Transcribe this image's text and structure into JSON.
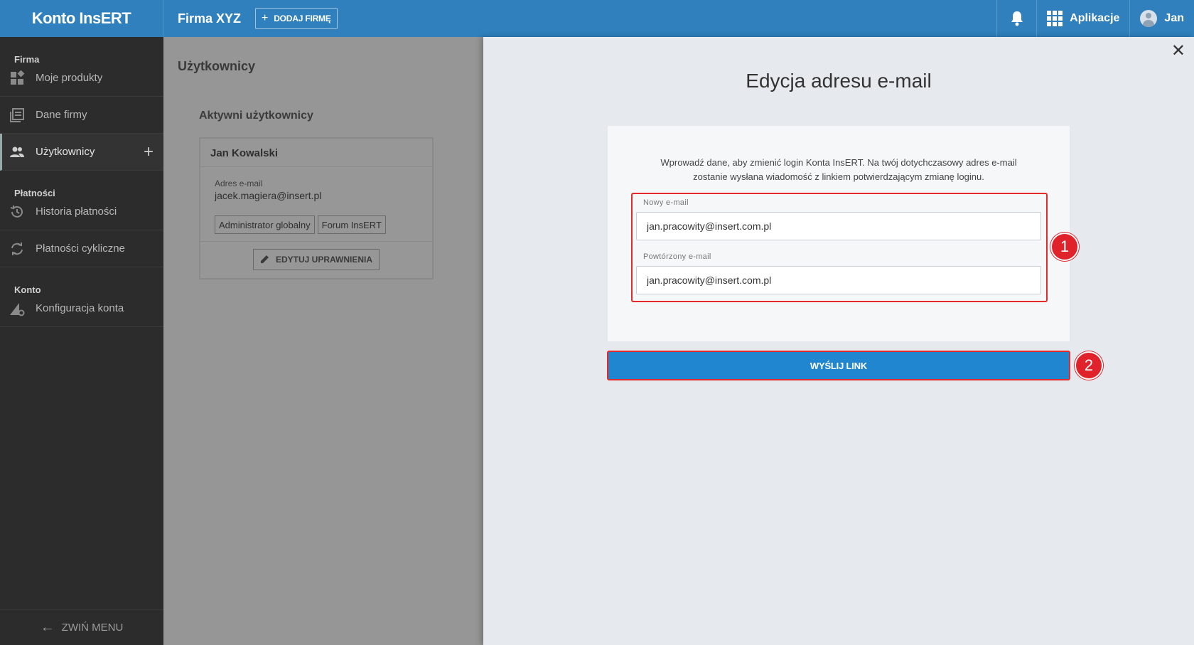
{
  "topbar": {
    "brand": "Konto InsERT",
    "company": "Firma XYZ",
    "add_company": "DODAJ FIRMĘ",
    "apps": "Aplikacje",
    "user": "Jan"
  },
  "sidebar": {
    "sections": [
      {
        "title": "Firma",
        "items": [
          {
            "label": "Moje produkty",
            "icon": "products-icon"
          },
          {
            "label": "Dane firmy",
            "icon": "company-data-icon"
          },
          {
            "label": "Użytkownicy",
            "icon": "users-icon",
            "active": true
          }
        ]
      },
      {
        "title": "Płatności",
        "items": [
          {
            "label": "Historia płatności",
            "icon": "history-icon"
          },
          {
            "label": "Płatności cykliczne",
            "icon": "recurring-icon"
          }
        ]
      },
      {
        "title": "Konto",
        "items": [
          {
            "label": "Konfiguracja konta",
            "icon": "account-settings-icon"
          }
        ]
      }
    ],
    "collapse": "ZWIŃ MENU"
  },
  "content": {
    "title": "Użytkownicy",
    "subtitle": "Aktywni użytkownicy",
    "user_card": {
      "name": "Jan Kowalski",
      "email_label": "Adres e-mail",
      "email": "jacek.magiera@insert.pl",
      "roles": [
        "Administrator globalny",
        "Forum InsERT"
      ],
      "edit_button": "EDYTUJ UPRAWNIENIA"
    }
  },
  "panel": {
    "title": "Edycja adresu e-mail",
    "description_line1": "Wprowadź dane, aby zmienić login Konta InsERT. Na twój dotychczasowy adres e-mail",
    "description_line2": "zostanie wysłana wiadomość z linkiem potwierdzającym zmianę loginu.",
    "new_email_label": "Nowy e-mail",
    "new_email_value": "jan.pracowity@insert.com.pl",
    "repeat_email_label": "Powtórzony e-mail",
    "repeat_email_value": "jan.pracowity@insert.com.pl",
    "send_button": "WYŚLIJ LINK",
    "badge1": "1",
    "badge2": "2"
  },
  "colors": {
    "topbar": "#2f80bd",
    "sidebar": "#2c2c2c",
    "primary_button": "#1f86cf",
    "highlight": "#e32b2b"
  }
}
